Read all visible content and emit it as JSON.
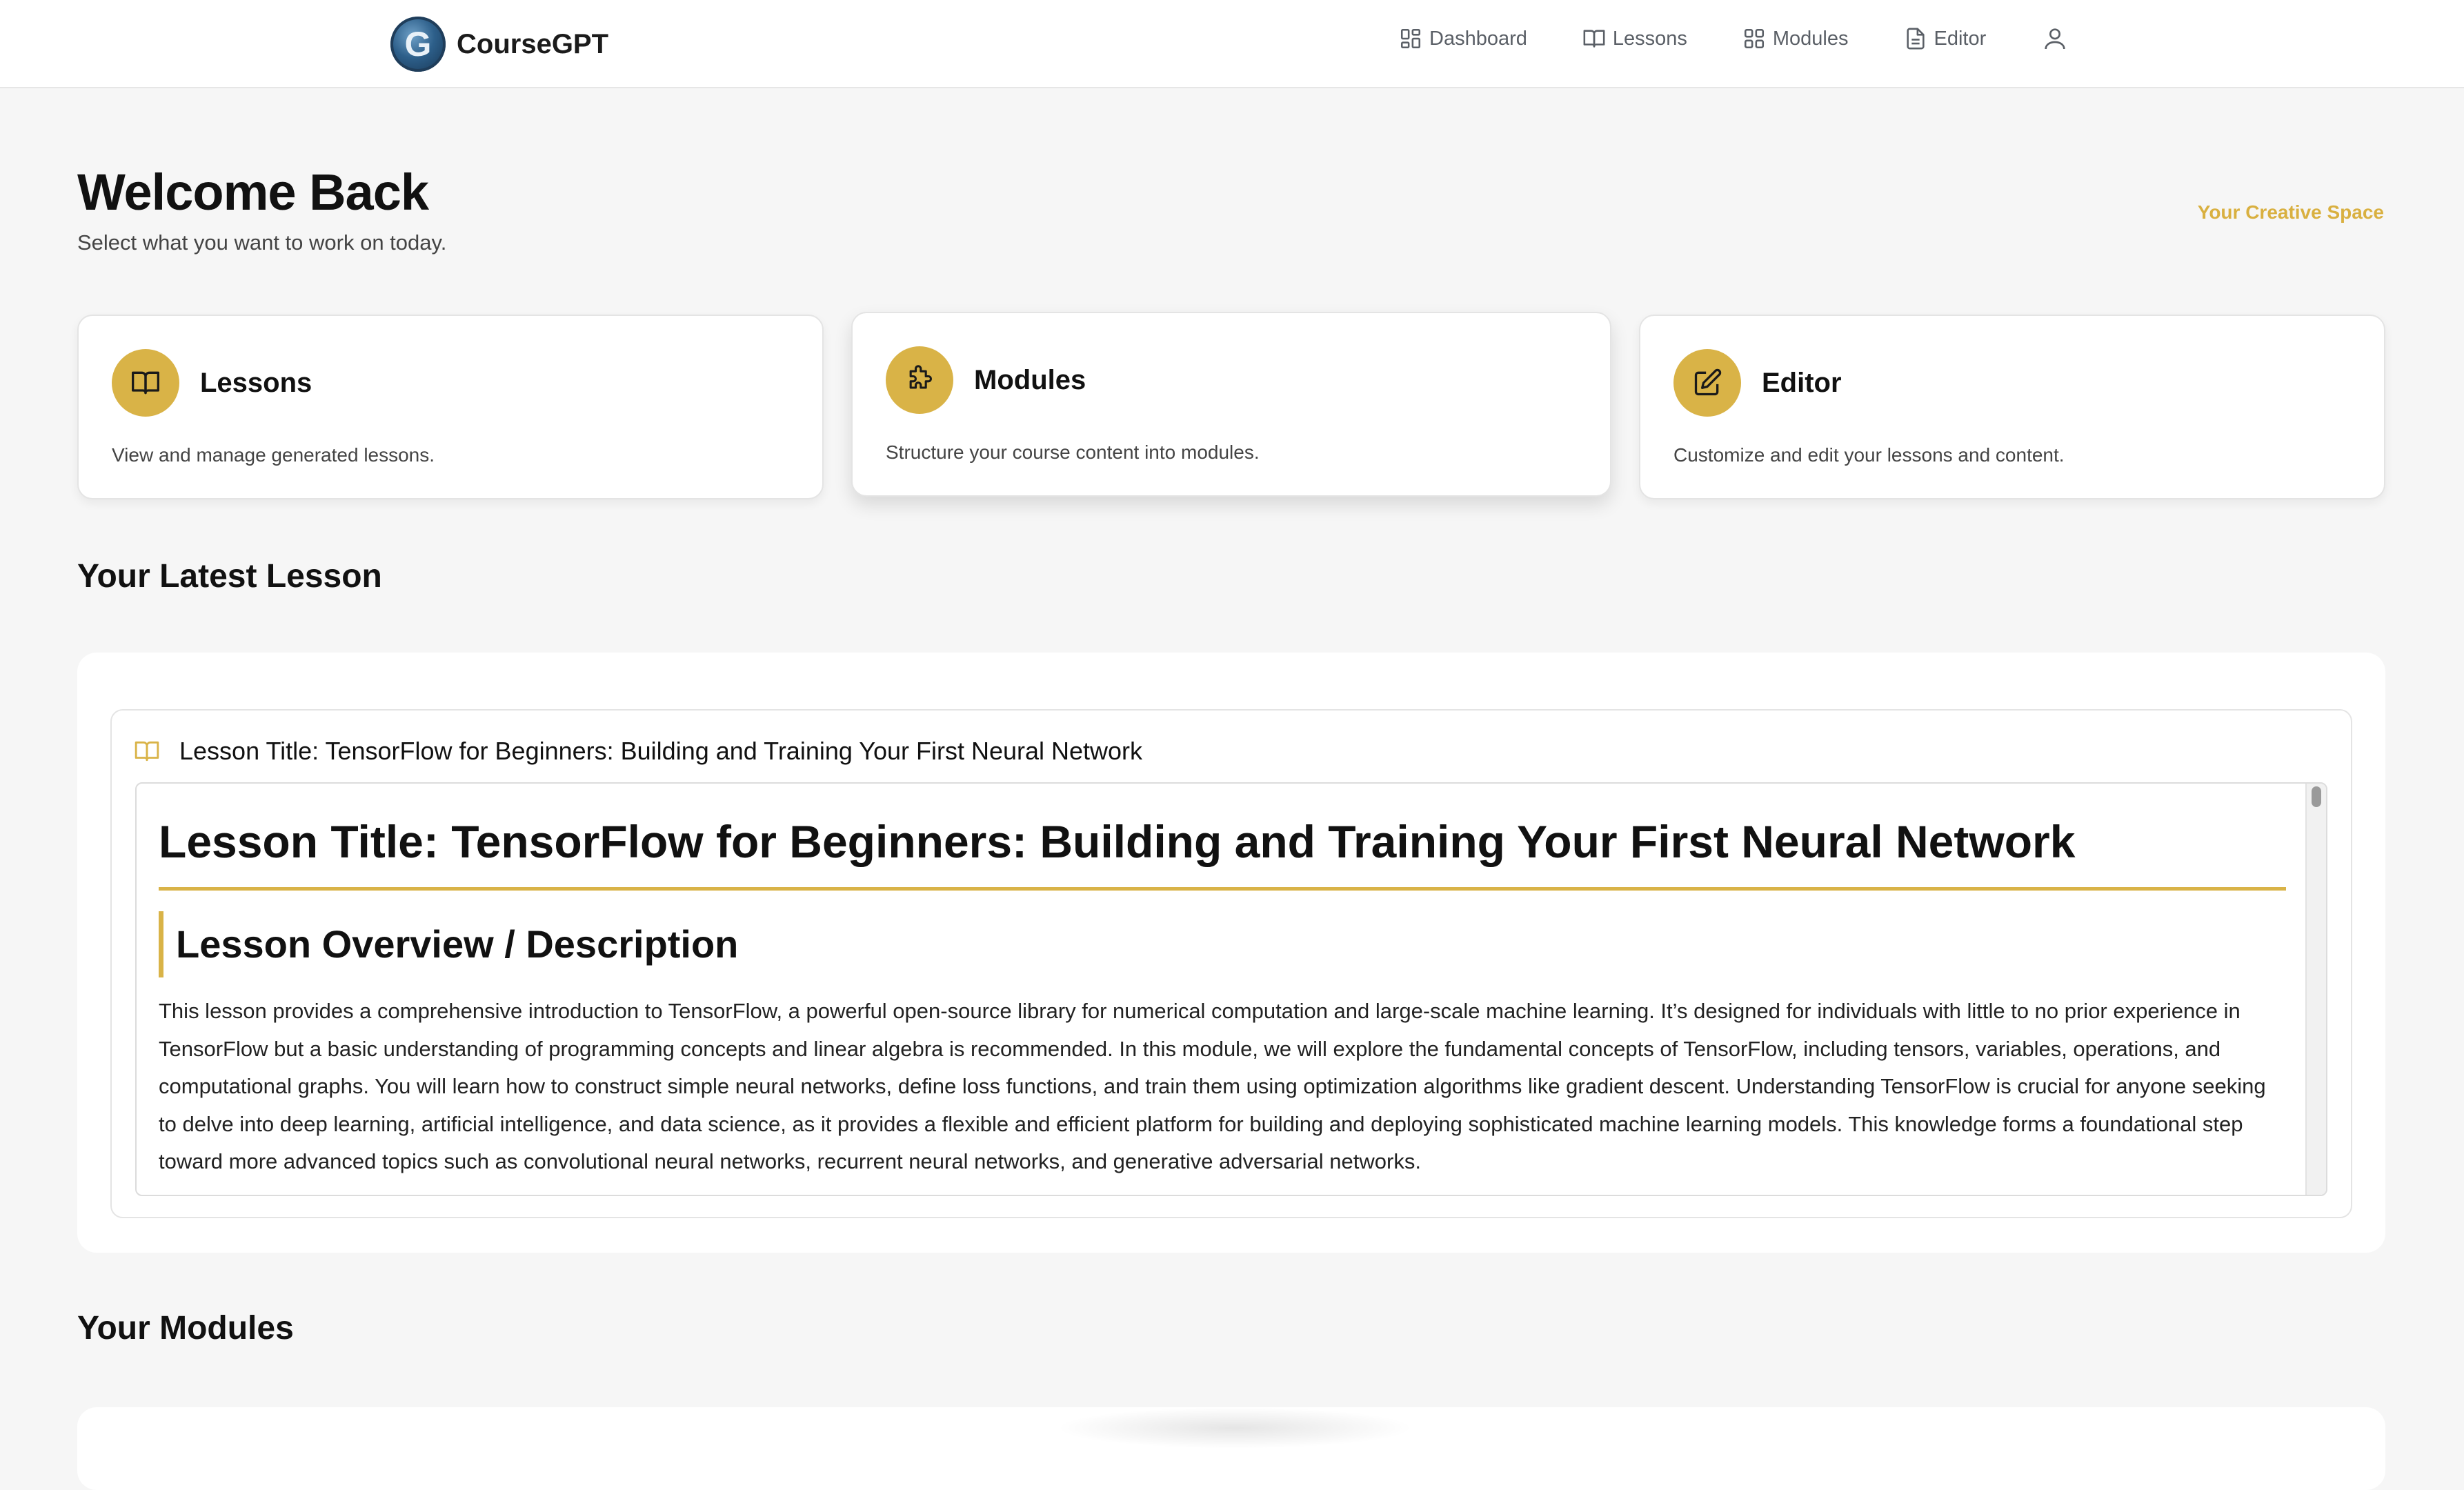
{
  "brand": {
    "name": "CourseGPT",
    "logo_icon": "coursegpt-logo"
  },
  "nav": {
    "items": [
      {
        "label": "Dashboard",
        "icon": "dashboard-icon"
      },
      {
        "label": "Lessons",
        "icon": "book-icon"
      },
      {
        "label": "Modules",
        "icon": "grid-icon"
      },
      {
        "label": "Editor",
        "icon": "document-icon"
      }
    ],
    "user_icon": "user-icon"
  },
  "header": {
    "title": "Welcome Back",
    "subtitle": "Select what you want to work on today.",
    "tagline": "Your Creative Space"
  },
  "cards": [
    {
      "title": "Lessons",
      "description": "View and manage generated lessons.",
      "icon": "book-open-icon"
    },
    {
      "title": "Modules",
      "description": "Structure your course content into modules.",
      "icon": "puzzle-icon"
    },
    {
      "title": "Editor",
      "description": "Customize and edit your lessons and content.",
      "icon": "pencil-square-icon"
    }
  ],
  "latest_lesson": {
    "section_title": "Your Latest Lesson",
    "card_title": "Lesson Title: TensorFlow for Beginners: Building and Training Your First Neural Network",
    "content": {
      "h1": "Lesson Title: TensorFlow for Beginners: Building and Training Your First Neural Network",
      "h2": "Lesson Overview / Description",
      "paragraph": "This lesson provides a comprehensive introduction to TensorFlow, a powerful open-source library for numerical computation and large-scale machine learning. It’s designed for individuals with little to no prior experience in TensorFlow but a basic understanding of programming concepts and linear algebra is recommended. In this module, we will explore the fundamental concepts of TensorFlow, including tensors, variables, operations, and computational graphs. You will learn how to construct simple neural networks, define loss functions, and train them using optimization algorithms like gradient descent. Understanding TensorFlow is crucial for anyone seeking to delve into deep learning, artificial intelligence, and data science, as it provides a flexible and efficient platform for building and deploying sophisticated machine learning models. This knowledge forms a foundational step toward more advanced topics such as convolutional neural networks, recurrent neural networks, and generative adversarial networks."
    }
  },
  "modules": {
    "section_title": "Your Modules"
  },
  "colors": {
    "accent": "#d9b347",
    "tagline": "#d9b040",
    "background": "#f6f6f6"
  }
}
